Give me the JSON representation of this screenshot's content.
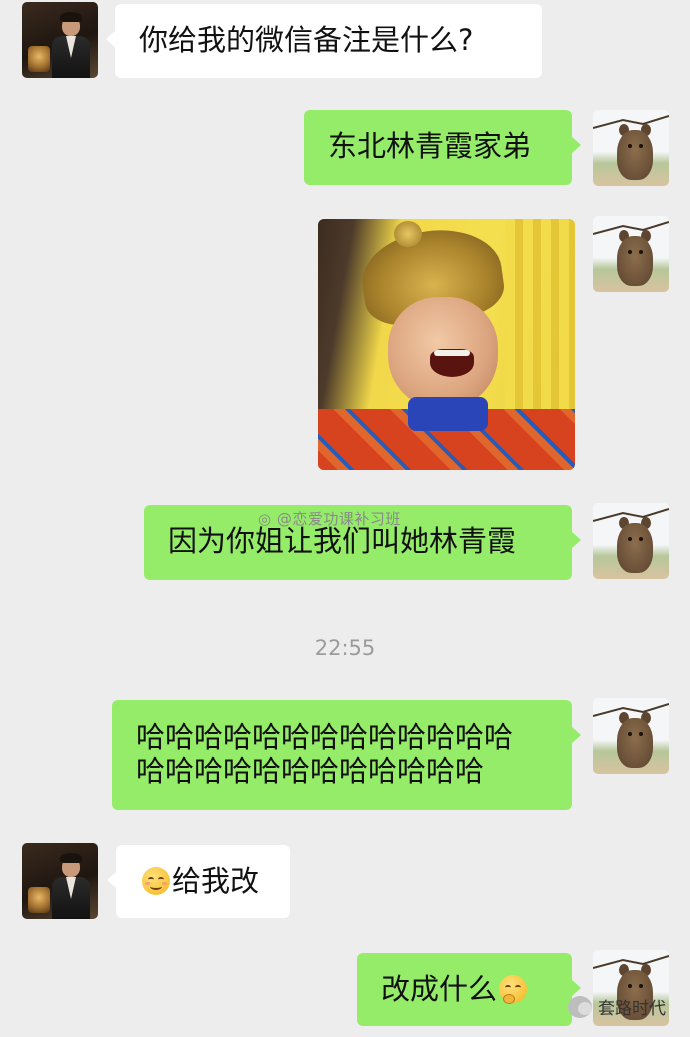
{
  "chat": {
    "messages": [
      {
        "side": "left",
        "text": "你给我的微信备注是什么?"
      },
      {
        "side": "right",
        "text": "东北林青霞家弟"
      },
      {
        "side": "right",
        "type": "image",
        "alt": "laughing meme"
      },
      {
        "side": "right",
        "text": "因为你姐让我们叫她林青霞"
      },
      {
        "side": "right",
        "line1": "哈哈哈哈哈哈哈哈哈哈哈哈哈",
        "line2": "哈哈哈哈哈哈哈哈哈哈哈哈"
      },
      {
        "side": "left",
        "emoji": "smiling-face-emoji",
        "text": "给我改"
      },
      {
        "side": "right",
        "text": "改成什么",
        "emoji": "thinking-face-emoji"
      }
    ],
    "timestamp": "22:55"
  },
  "watermark": "@恋爱功课补习班",
  "account_mark": "套路时代",
  "colors": {
    "background": "#ededed",
    "bubble_green": "#95ec69",
    "bubble_white": "#ffffff",
    "timestamp_gray": "#9b9b9b"
  }
}
